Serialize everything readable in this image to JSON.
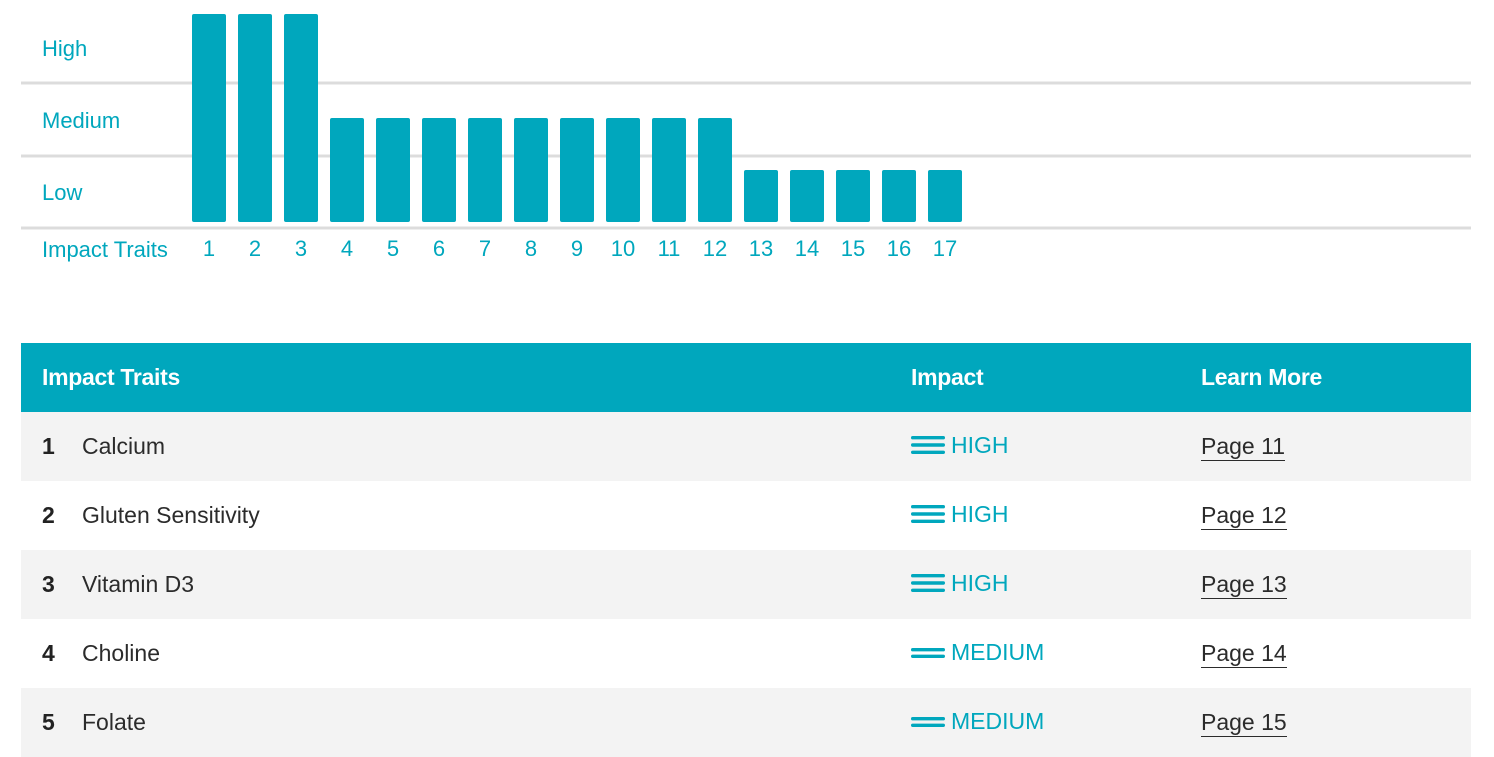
{
  "chart_data": {
    "type": "bar",
    "levels": [
      "Low",
      "Medium",
      "High"
    ],
    "level_labels": [
      "High",
      "Medium",
      "Low"
    ],
    "xlabel": "Impact Traits",
    "categories": [
      "1",
      "2",
      "3",
      "4",
      "5",
      "6",
      "7",
      "8",
      "9",
      "10",
      "11",
      "12",
      "13",
      "14",
      "15",
      "16",
      "17"
    ],
    "values": [
      "High",
      "High",
      "High",
      "Medium",
      "Medium",
      "Medium",
      "Medium",
      "Medium",
      "Medium",
      "Medium",
      "Medium",
      "Medium",
      "Low",
      "Low",
      "Low",
      "Low",
      "Low"
    ],
    "grid": true,
    "bar_color": "#00a7bd"
  },
  "table": {
    "headers": {
      "trait": "Impact Traits",
      "impact": "Impact",
      "learn": "Learn More"
    },
    "rows": [
      {
        "num": "1",
        "trait": "Calcium",
        "impact": "HIGH",
        "impact_icon": "three-bars-icon",
        "link": "Page 11"
      },
      {
        "num": "2",
        "trait": "Gluten Sensitivity",
        "impact": "HIGH",
        "impact_icon": "three-bars-icon",
        "link": "Page 12"
      },
      {
        "num": "3",
        "trait": "Vitamin D3",
        "impact": "HIGH",
        "impact_icon": "three-bars-icon",
        "link": "Page 13"
      },
      {
        "num": "4",
        "trait": "Choline",
        "impact": "MEDIUM",
        "impact_icon": "two-bars-icon",
        "link": "Page 14"
      },
      {
        "num": "5",
        "trait": "Folate",
        "impact": "MEDIUM",
        "impact_icon": "two-bars-icon",
        "link": "Page 15"
      }
    ]
  },
  "colors": {
    "accent": "#00a7bd",
    "row_alt": "#f3f3f3",
    "text": "#2b2b2b"
  }
}
